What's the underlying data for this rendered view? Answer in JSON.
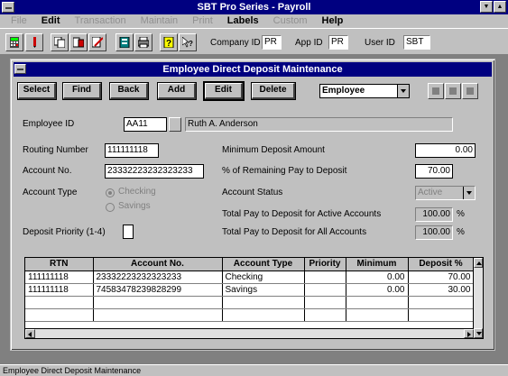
{
  "app": {
    "title": "SBT Pro Series - Payroll"
  },
  "menu": [
    {
      "label": "File",
      "enabled": false
    },
    {
      "label": "Edit",
      "enabled": true
    },
    {
      "label": "Transaction",
      "enabled": false
    },
    {
      "label": "Maintain",
      "enabled": false
    },
    {
      "label": "Print",
      "enabled": false
    },
    {
      "label": "Labels",
      "enabled": true
    },
    {
      "label": "Custom",
      "enabled": false
    },
    {
      "label": "Help",
      "enabled": true
    }
  ],
  "toolbar": {
    "company_label": "Company ID",
    "company_value": "PR",
    "app_id_label": "App ID",
    "app_id_value": "PR",
    "user_id_label": "User ID",
    "user_id_value": "SBT"
  },
  "window": {
    "title": "Employee Direct Deposit Maintenance",
    "buttons": {
      "select": "Select",
      "find": "Find",
      "back": "Back",
      "add": "Add",
      "edit": "Edit",
      "delete": "Delete"
    },
    "lookup_select": "Employee"
  },
  "form": {
    "employee_id_label": "Employee ID",
    "employee_id": "AA11",
    "employee_name": "Ruth A. Anderson",
    "routing_label": "Routing Number",
    "routing_number": "111111118",
    "account_label": "Account No.",
    "account_number": "23332223232323233",
    "account_type_label": "Account Type",
    "account_type_options": [
      "Checking",
      "Savings"
    ],
    "account_type_selected": "Checking",
    "priority_label": "Deposit Priority (1-4)",
    "priority_value": "",
    "min_deposit_label": "Minimum Deposit Amount",
    "min_deposit": "0.00",
    "pct_remaining_label": "% of Remaining Pay to Deposit",
    "pct_remaining": "70.00",
    "status_label": "Account Status",
    "status_value": "Active",
    "total_active_label": "Total Pay to Deposit for Active Accounts",
    "total_active": "100.00",
    "total_all_label": "Total Pay to Deposit for All Accounts",
    "total_all": "100.00",
    "pct_sign": "%"
  },
  "grid": {
    "columns": [
      "RTN",
      "Account No.",
      "Account Type",
      "Priority",
      "Minimum",
      "Deposit %"
    ],
    "rows": [
      [
        "111111118",
        "23332223232323233",
        "Checking",
        "",
        "0.00",
        "70.00"
      ],
      [
        "111111118",
        "74583478239828299",
        "Savings",
        "",
        "0.00",
        "30.00"
      ]
    ]
  },
  "status_bar": {
    "text": "Employee Direct Deposit Maintenance"
  },
  "colors": {
    "title_bar": "#000080",
    "face": "#c0c0c0",
    "desktop": "#808080"
  }
}
